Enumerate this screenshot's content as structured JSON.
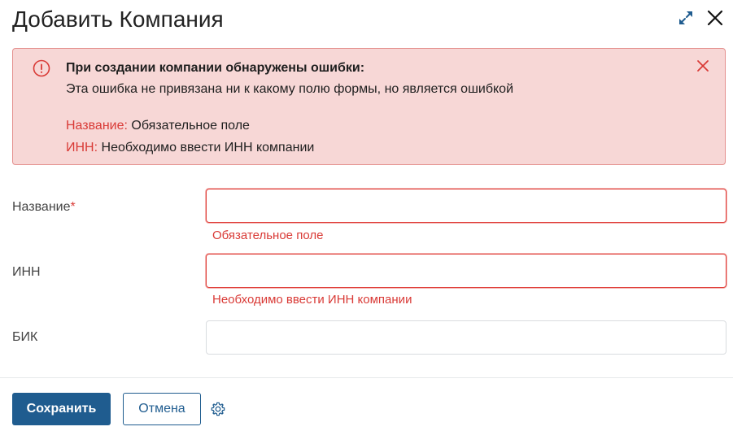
{
  "dialog": {
    "title": "Добавить Компания"
  },
  "icons": {
    "expand": "expand-arrows-icon",
    "close": "close-icon",
    "alert": "exclamation-circle-icon",
    "alert_close": "close-icon",
    "settings": "gear-icon"
  },
  "alert": {
    "heading": "При создании компании обнаружены ошибки:",
    "text": "Эта ошибка не привязана ни к какому полю формы, но является ошибкой",
    "items": [
      {
        "field": "Название:",
        "message": "Обязательное поле"
      },
      {
        "field": "ИНН:",
        "message": "Необходимо ввести ИНН компании"
      }
    ]
  },
  "form": {
    "name": {
      "label": "Название",
      "required_mark": "*",
      "value": "",
      "error": "Обязательное поле"
    },
    "inn": {
      "label": "ИНН",
      "value": "",
      "error": "Необходимо ввести ИНН компании"
    },
    "bik": {
      "label": "БИК",
      "value": ""
    }
  },
  "footer": {
    "save_label": "Сохранить",
    "cancel_label": "Отмена"
  },
  "colors": {
    "primary": "#1f5c8f",
    "error": "#d93a36",
    "alert_bg": "#f7d7d6",
    "alert_border": "#e4908e"
  }
}
